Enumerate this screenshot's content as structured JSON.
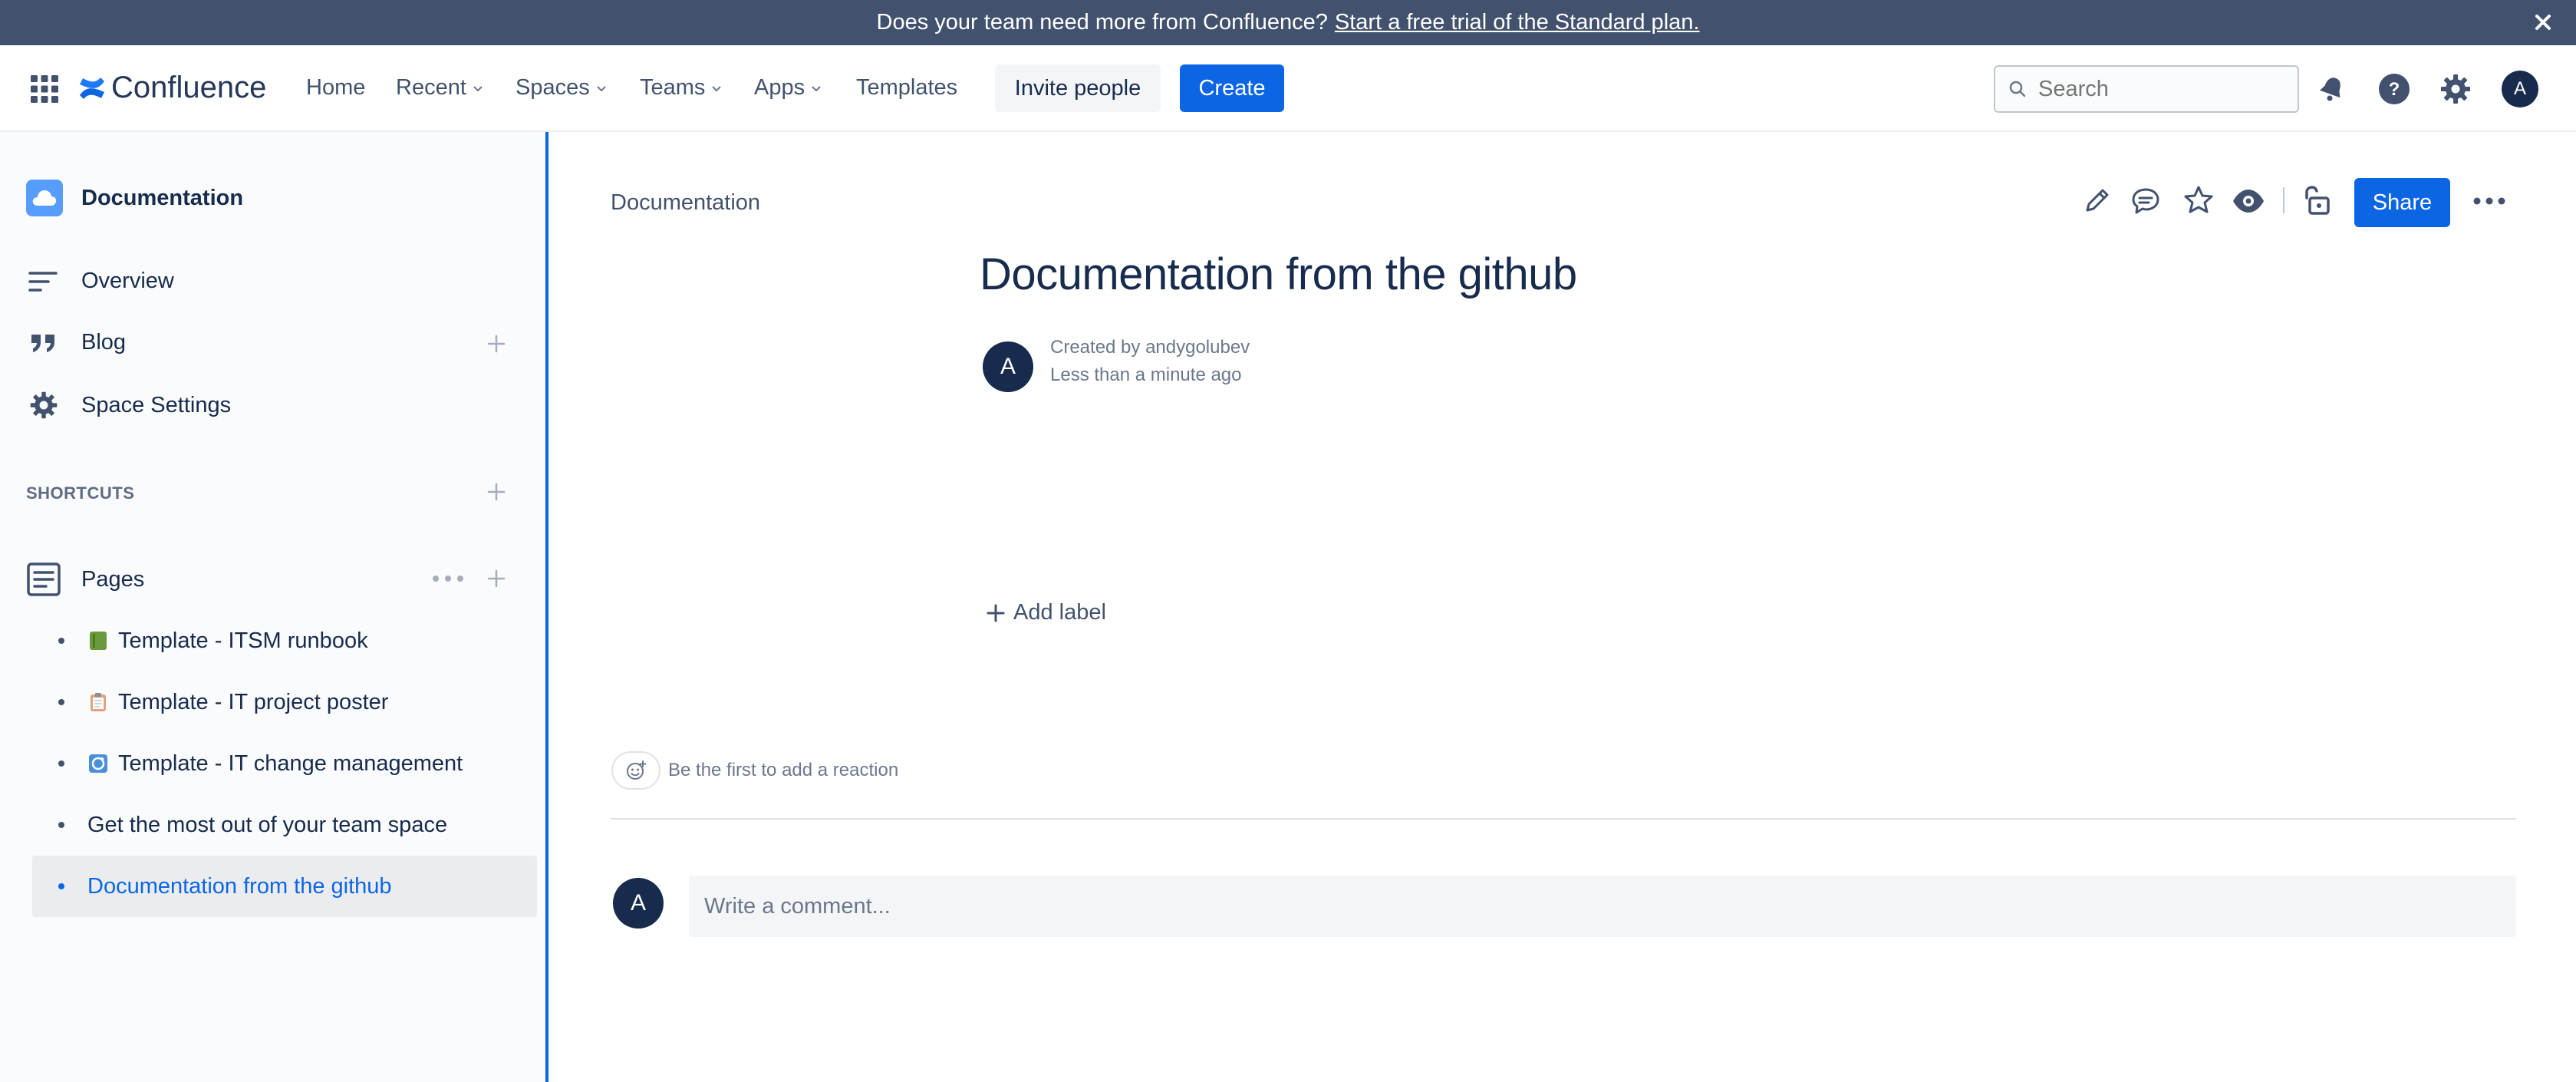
{
  "banner": {
    "text": "Does your team need more from Confluence?",
    "link": "Start a free trial of the Standard plan."
  },
  "topnav": {
    "logo": "Confluence",
    "items": [
      "Home",
      "Recent",
      "Spaces",
      "Teams",
      "Apps",
      "Templates"
    ],
    "invite_label": "Invite people",
    "create_label": "Create",
    "search_placeholder": "Search",
    "avatar_initial": "A",
    "brand_color": "#0c66e4"
  },
  "sidebar": {
    "space_name": "Documentation",
    "nav": [
      "Overview",
      "Blog",
      "Space Settings"
    ],
    "shortcuts_label": "SHORTCUTS",
    "pages_label": "Pages",
    "pages": [
      {
        "label": "Template - ITSM runbook",
        "icon": "green-book-icon",
        "color": "#6a9a3b"
      },
      {
        "label": "Template - IT project poster",
        "icon": "clipboard-icon",
        "color": "#e2a37a"
      },
      {
        "label": "Template - IT change management",
        "icon": "refresh-icon",
        "color": "#4a90d9"
      },
      {
        "label": "Get the most out of your team space"
      },
      {
        "label": "Documentation from the github",
        "selected": true
      }
    ]
  },
  "page": {
    "breadcrumb": "Documentation",
    "share_label": "Share",
    "title": "Documentation from the github",
    "created_by": "Created by andygolubev",
    "time": "Less than a minute ago",
    "author_initial": "A",
    "add_label": "Add label",
    "reaction_text": "Be the first to add a reaction",
    "comment_placeholder": "Write a comment...",
    "comment_avatar_initial": "A"
  }
}
